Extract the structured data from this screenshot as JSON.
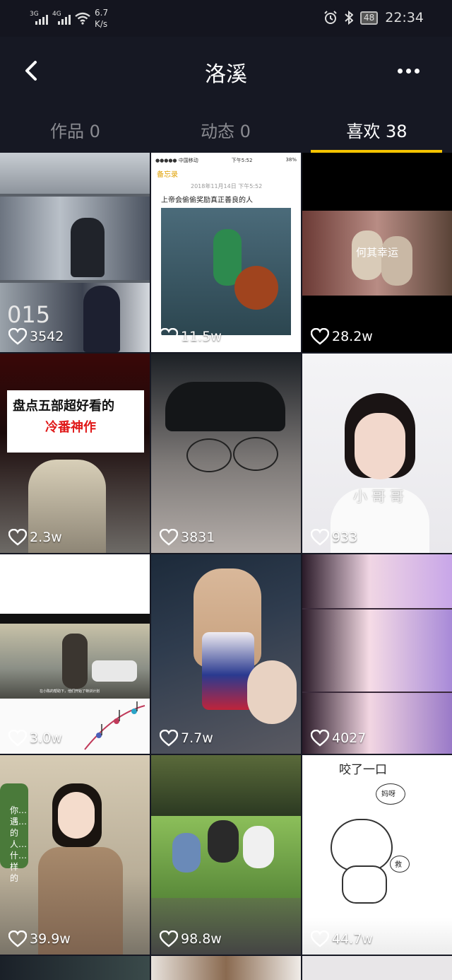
{
  "status_bar": {
    "sig1_label": "3G",
    "sig2_label": "4G",
    "net_speed_value": "6.7",
    "net_speed_unit": "K/s",
    "battery": "48",
    "time": "22:34"
  },
  "header": {
    "title": "洛溪"
  },
  "tabs": [
    {
      "label": "作品 0"
    },
    {
      "label": "动态 0"
    },
    {
      "label": "喜欢 38"
    }
  ],
  "colors": {
    "background": "#161823",
    "tab_accent": "#f5c400",
    "inactive_tab": "#8a8b91"
  },
  "grid": [
    {
      "likes": "3542",
      "caption": "015"
    },
    {
      "likes": "11.5w",
      "memo_title": "备忘录",
      "memo_date": "2018年11月14日 下午5:52",
      "memo_text": "上帝会偷偷奖励真正善良的人",
      "carrier": "●●●●● 中国移动",
      "phone_time": "下午5:52",
      "phone_battery": "38%"
    },
    {
      "likes": "28.2w",
      "caption": "何其幸运"
    },
    {
      "likes": "2.3w",
      "headline1": "盘点五部超好看的",
      "headline2": "冷番神作"
    },
    {
      "likes": "3831"
    },
    {
      "likes": "933",
      "caption": "小哥哥"
    },
    {
      "likes": "3.0w",
      "subtitle": "在小陈的帮助下，他们开始了特训计划"
    },
    {
      "likes": "7.7w"
    },
    {
      "likes": "4027"
    },
    {
      "likes": "39.9w",
      "side_text": "你…遇…的人…什…样的"
    },
    {
      "likes": "98.8w"
    },
    {
      "likes": "44.7w",
      "top_text": "咬了一口",
      "bubble1": "妈呀",
      "bubble2": "救"
    }
  ]
}
